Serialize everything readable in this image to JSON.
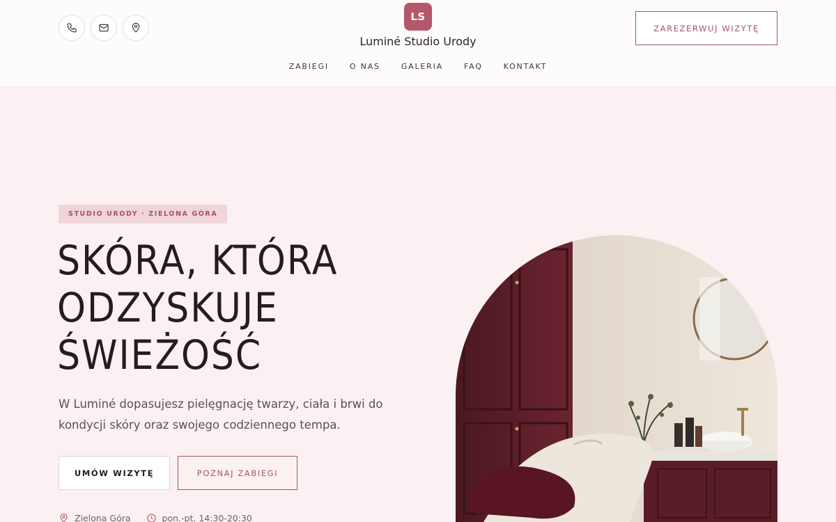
{
  "header": {
    "logo_text": "LS",
    "brand_name": "Luminé Studio Urody",
    "book_label": "ZAREZERWUJ WIZYTĘ",
    "contact_icons": [
      "phone-icon",
      "mail-icon",
      "map-pin-icon"
    ],
    "nav": [
      "ZABIEGI",
      "O NAS",
      "GALERIA",
      "FAQ",
      "KONTAKT"
    ]
  },
  "hero": {
    "badge": "STUDIO URODY · ZIELONA GÓRA",
    "title_lines": [
      "SKÓRA, KTÓRA",
      "ODZYSKUJE",
      "ŚWIEŻOŚĆ"
    ],
    "subtitle": "W Luminé dopasujesz pielęgnację twarzy, ciała i brwi do kondycji skóry oraz swojego codziennego tempa.",
    "primary_button": "UMÓW WIZYTĘ",
    "secondary_button": "POZNAJ ZABIEGI",
    "location": "Zielona Góra",
    "hours": "pon.-pt. 14:30-20:30"
  },
  "colors": {
    "accent": "#b4576b",
    "background": "#fcf1f2",
    "header_bg": "#fdfcfb",
    "badge_bg": "#efd5db"
  }
}
